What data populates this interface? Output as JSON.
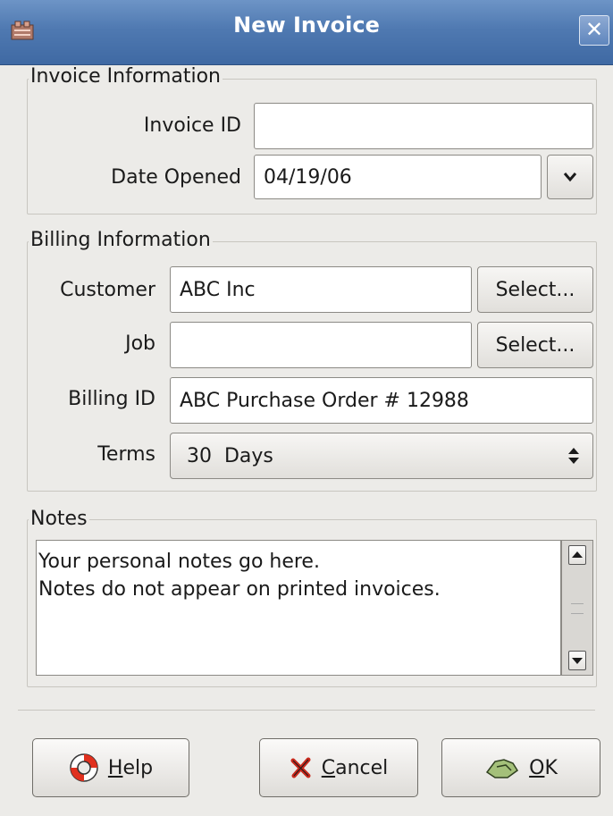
{
  "window": {
    "title": "New Invoice",
    "app_icon": "invoice-icon",
    "close_icon": "close-icon"
  },
  "invoice_info": {
    "legend": "Invoice Information",
    "invoice_id_label": "Invoice ID",
    "invoice_id_value": "",
    "date_opened_label": "Date Opened",
    "date_opened_value": "04/19/06"
  },
  "billing_info": {
    "legend": "Billing Information",
    "customer_label": "Customer",
    "customer_value": "ABC Inc",
    "customer_select": "Select...",
    "job_label": "Job",
    "job_value": "",
    "job_select": "Select...",
    "billing_id_label": "Billing ID",
    "billing_id_value": "ABC Purchase Order # 12988",
    "terms_label": "Terms",
    "terms_value": "30  Days"
  },
  "notes": {
    "legend": "Notes",
    "text": "Your personal notes go here.\nNotes do not appear on printed invoices."
  },
  "buttons": {
    "help": {
      "mnemonic": "H",
      "rest": "elp"
    },
    "cancel": {
      "mnemonic": "C",
      "rest": "ancel"
    },
    "ok": {
      "mnemonic": "O",
      "rest": "K"
    }
  },
  "colors": {
    "titlebar": "#4f79b1",
    "background": "#ecebe8"
  }
}
